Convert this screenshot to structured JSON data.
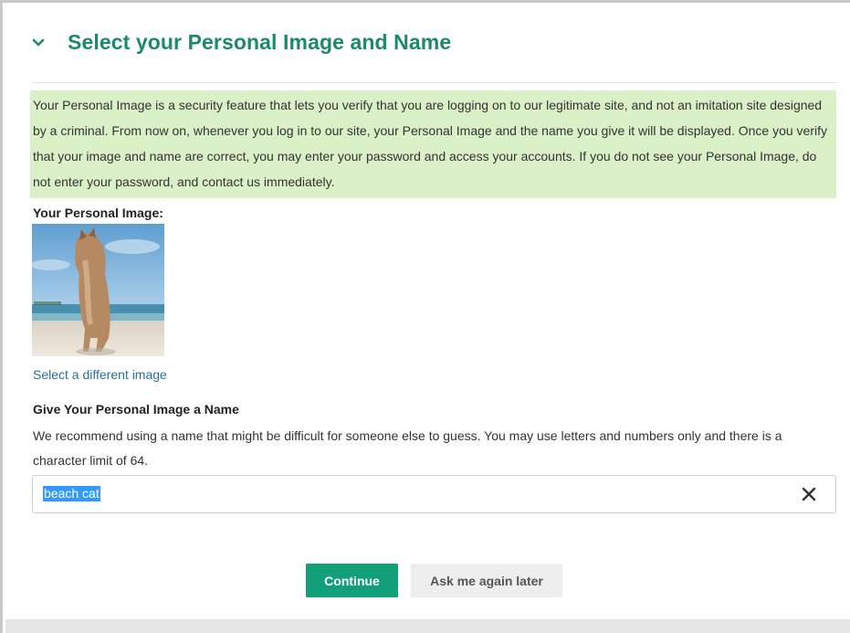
{
  "section": {
    "title": "Select your Personal Image and Name"
  },
  "notice": {
    "text": "Your Personal Image is a security feature that lets you verify that you are logging on to our legitimate site, and not an imitation site designed by a criminal. From now on, whenever you log in to our site, your Personal Image and the name you give it will be displayed. Once you verify that your image and name are correct, you may enter your password and access your accounts. If you do not see your Personal Image, do not enter your password, and contact us immediately."
  },
  "image_section": {
    "label": "Your Personal Image:",
    "change_link": "Select a different image"
  },
  "name_section": {
    "label": "Give Your Personal Image a Name",
    "help": "We recommend using a name that might be difficult for someone else to guess. You may use letters and numbers only and there is a character limit of 64.",
    "value": "beach cat"
  },
  "actions": {
    "continue_label": "Continue",
    "later_label": "Ask me again later"
  },
  "icons": {
    "collapse": "chevron-down-icon",
    "clear": "close-icon"
  },
  "colors": {
    "accent": "#1b8a6b",
    "primary_button": "#12a07a",
    "notice_bg": "#daf0c7",
    "link": "#2a6f9b",
    "selection": "#3399ff"
  }
}
